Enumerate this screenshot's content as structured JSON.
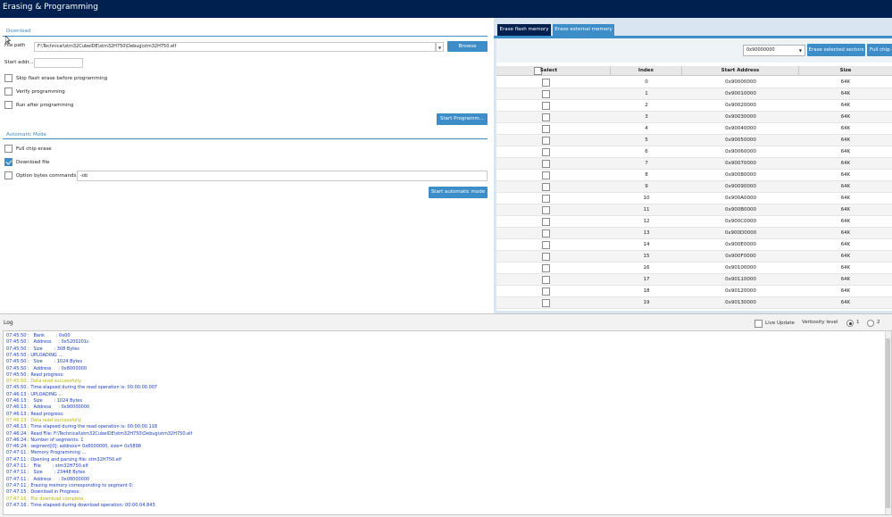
{
  "window": {
    "title": "Erasing & Programming"
  },
  "download": {
    "section_title": "Download",
    "file_path_label": "File path",
    "file_path_value": "F:\\Technical\\stm32CubeIDE\\stm32H750\\Debug\\stm32H750.elf",
    "browse_label": "Browse",
    "start_address_label": "Start addr...",
    "start_address_value": "",
    "skip_flash_erase_label": "Skip flash erase before programming",
    "skip_flash_erase_checked": false,
    "verify_label": "Verify programming",
    "verify_checked": false,
    "run_after_label": "Run after programming",
    "run_after_checked": false,
    "start_programming_label": "Start Programm..."
  },
  "automatic": {
    "section_title": "Automatic Mode",
    "full_chip_erase_label": "Full chip erase",
    "full_chip_erase_checked": false,
    "download_file_label": "Download file",
    "download_file_checked": true,
    "option_bytes_label": "Option bytes commands",
    "option_bytes_checked": false,
    "option_bytes_value": "-ob",
    "start_automatic_label": "Start automatic mode"
  },
  "flash_panel": {
    "tabs": [
      {
        "label": "Erase flash memory",
        "active": true
      },
      {
        "label": "Erase external memory",
        "active": false
      }
    ],
    "address_select": "0x90000000",
    "erase_selected_label": "Erase selected sectors",
    "full_chip_label": "Full chip e",
    "columns": [
      "Select",
      "Index",
      "Start Address",
      "Size"
    ],
    "rows": [
      {
        "index": "0",
        "address": "0x90000000",
        "size": "64K"
      },
      {
        "index": "1",
        "address": "0x90010000",
        "size": "64K"
      },
      {
        "index": "2",
        "address": "0x90020000",
        "size": "64K"
      },
      {
        "index": "3",
        "address": "0x90030000",
        "size": "64K"
      },
      {
        "index": "4",
        "address": "0x90040000",
        "size": "64K"
      },
      {
        "index": "5",
        "address": "0x90050000",
        "size": "64K"
      },
      {
        "index": "6",
        "address": "0x90060000",
        "size": "64K"
      },
      {
        "index": "7",
        "address": "0x90070000",
        "size": "64K"
      },
      {
        "index": "8",
        "address": "0x90080000",
        "size": "64K"
      },
      {
        "index": "9",
        "address": "0x90090000",
        "size": "64K"
      },
      {
        "index": "10",
        "address": "0x900A0000",
        "size": "64K"
      },
      {
        "index": "11",
        "address": "0x900B0000",
        "size": "64K"
      },
      {
        "index": "12",
        "address": "0x900C0000",
        "size": "64K"
      },
      {
        "index": "13",
        "address": "0x900D0000",
        "size": "64K"
      },
      {
        "index": "14",
        "address": "0x900E0000",
        "size": "64K"
      },
      {
        "index": "15",
        "address": "0x900F0000",
        "size": "64K"
      },
      {
        "index": "16",
        "address": "0x90100000",
        "size": "64K"
      },
      {
        "index": "17",
        "address": "0x90110000",
        "size": "64K"
      },
      {
        "index": "18",
        "address": "0x90120000",
        "size": "64K"
      },
      {
        "index": "19",
        "address": "0x90130000",
        "size": "64K"
      }
    ]
  },
  "log": {
    "title": "Log",
    "live_update_label": "Live Update",
    "verbosity_label": "Verbosity level",
    "verbosity_options": [
      "1",
      "2"
    ],
    "verbosity_selected": "1",
    "colors": {
      "info": "#1a3cc8",
      "success": "#b4b400"
    },
    "lines": [
      {
        "text": "07:45:50 :   Bank        : 0x00",
        "kind": "info"
      },
      {
        "text": "07:45:50 :   Address     : 0x5200201c",
        "kind": "info"
      },
      {
        "text": "07:45:50 :   Size        : 308 Bytes",
        "kind": "info"
      },
      {
        "text": "07:45:50 : UPLOADING ...",
        "kind": "info"
      },
      {
        "text": "07:45:50 :   Size        : 1024 Bytes",
        "kind": "info"
      },
      {
        "text": "07:45:50 :   Address     : 0x8000000",
        "kind": "info"
      },
      {
        "text": "07:45:50 : Read progress:",
        "kind": "info"
      },
      {
        "text": "07:45:50 : Data read successfully",
        "kind": "success"
      },
      {
        "text": "07:45:50 : Time elapsed during the read operation is: 00:00:00.007",
        "kind": "info"
      },
      {
        "text": "07:46:13 : UPLOADING ...",
        "kind": "info"
      },
      {
        "text": "07:46:13 :   Size        : 1024 Bytes",
        "kind": "info"
      },
      {
        "text": "07:46:13 :   Address     : 0x90000000",
        "kind": "info"
      },
      {
        "text": "07:46:13 : Read progress:",
        "kind": "info"
      },
      {
        "text": "07:46:13 : Data read successfully",
        "kind": "success"
      },
      {
        "text": "07:46:13 : Time elapsed during the read operation is: 00:00:00.118",
        "kind": "info"
      },
      {
        "text": "07:46:24 : Read File: F:\\Technical\\stm32CubeIDE\\stm32H750\\Debug\\stm32H750.elf",
        "kind": "info"
      },
      {
        "text": "07:46:24 : Number of segments: 1",
        "kind": "info"
      },
      {
        "text": "07:46:24 : segment[0]: address= 0x8000000, size= 0x5898",
        "kind": "info"
      },
      {
        "text": "07:47:11 : Memory Programming ...",
        "kind": "info"
      },
      {
        "text": "07:47:11 : Opening and parsing file: stm32H750.elf",
        "kind": "info"
      },
      {
        "text": "07:47:11 :   File        : stm32H750.elf",
        "kind": "info"
      },
      {
        "text": "07:47:11 :   Size        : 23448 Bytes",
        "kind": "info"
      },
      {
        "text": "07:47:11 :   Address     : 0x08000000",
        "kind": "info"
      },
      {
        "text": "07:47:11 : Erasing memory corresponding to segment 0:",
        "kind": "info"
      },
      {
        "text": "07:47:15 : Download in Progress:",
        "kind": "info"
      },
      {
        "text": "07:47:16 : File download complete",
        "kind": "success"
      },
      {
        "text": "07:47:16 : Time elapsed during download operation: 00:00:04.843",
        "kind": "info"
      }
    ]
  }
}
